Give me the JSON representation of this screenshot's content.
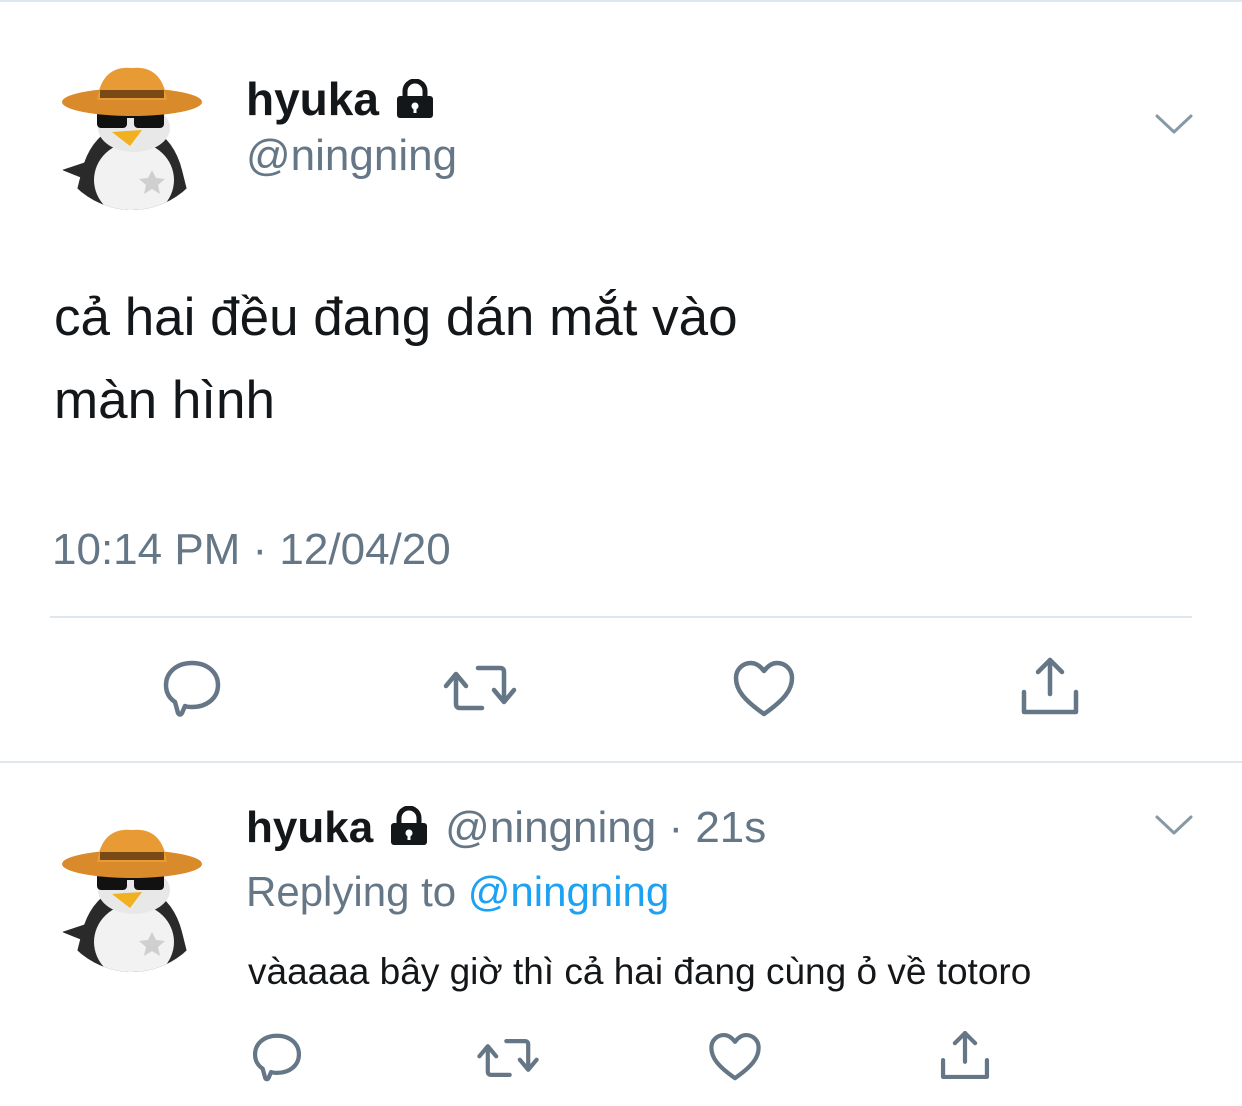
{
  "main_tweet": {
    "display_name": "hyuka",
    "handle": "@ningning",
    "text_line1": "cả hai đều đang dán mắt vào",
    "text_line2": "màn hình",
    "timestamp": "10:14 PM · 12/04/20"
  },
  "reply_tweet": {
    "display_name": "hyuka",
    "handle_time": "@ningning · 21s",
    "replying_prefix": "Replying to",
    "replying_mention": "@ningning",
    "text": "vàaaaa bây giờ thì cả hai đang cùng ỏ về totoro"
  },
  "icons": [
    "lock-icon",
    "chevron-down-icon",
    "reply-icon",
    "retweet-icon",
    "like-icon",
    "share-icon"
  ],
  "colors": {
    "text": "#14171a",
    "secondary": "#657786",
    "link": "#1da1f2",
    "divider": "#e1e8ed"
  }
}
